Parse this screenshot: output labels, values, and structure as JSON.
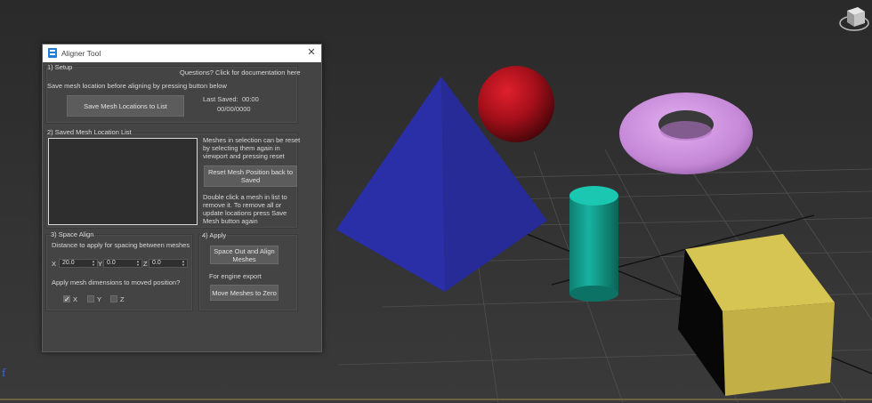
{
  "window": {
    "title": "Aligner Tool",
    "close_glyph": "✕"
  },
  "setup": {
    "group_label": "1) Setup",
    "docs_link": "Questions? Click for documentation here",
    "instruction": "Save mesh location before aligning by pressing button below",
    "save_button": "Save Mesh Locations to List",
    "last_saved_label": "Last Saved:",
    "last_saved_time": "00:00",
    "last_saved_date": "00/00/0000"
  },
  "saved_list": {
    "group_label": "2) Saved Mesh Location List",
    "reset_info": [
      "Meshes in selection can be reset",
      "by selecting them again in",
      "viewport and pressing reset"
    ],
    "reset_button": [
      "Reset Mesh Position back to",
      "Saved"
    ],
    "remove_info": [
      "Double click a mesh in list to",
      "remove it. To remove all or",
      "update locations press Save",
      "Mesh button again"
    ]
  },
  "space_align": {
    "group_label": "3) Space Align",
    "distance_label": "Distance to apply for spacing between meshes",
    "x_label": "X",
    "x_value": "20.0",
    "y_label": "Y",
    "y_value": "0.0",
    "z_label": "Z",
    "z_value": "0.0",
    "dims_label": "Apply mesh dimensions to moved position?",
    "chk_x_label": "X",
    "chk_x_checked": true,
    "chk_y_label": "Y",
    "chk_y_checked": false,
    "chk_z_label": "Z",
    "chk_z_checked": false
  },
  "apply": {
    "group_label": "4) Apply",
    "space_button": [
      "Space Out and Align",
      "Meshes"
    ],
    "engine_label": "For engine export",
    "zero_button": "Move Meshes to Zero"
  },
  "viewport": {
    "axis_label": "f",
    "colors": {
      "pyramid": "#2a2faa",
      "sphere": "#a8101a",
      "torus": "#c88ad8",
      "cylinder": "#13a896",
      "cube": "#c9b94a",
      "background": "#2b2b2b"
    }
  }
}
